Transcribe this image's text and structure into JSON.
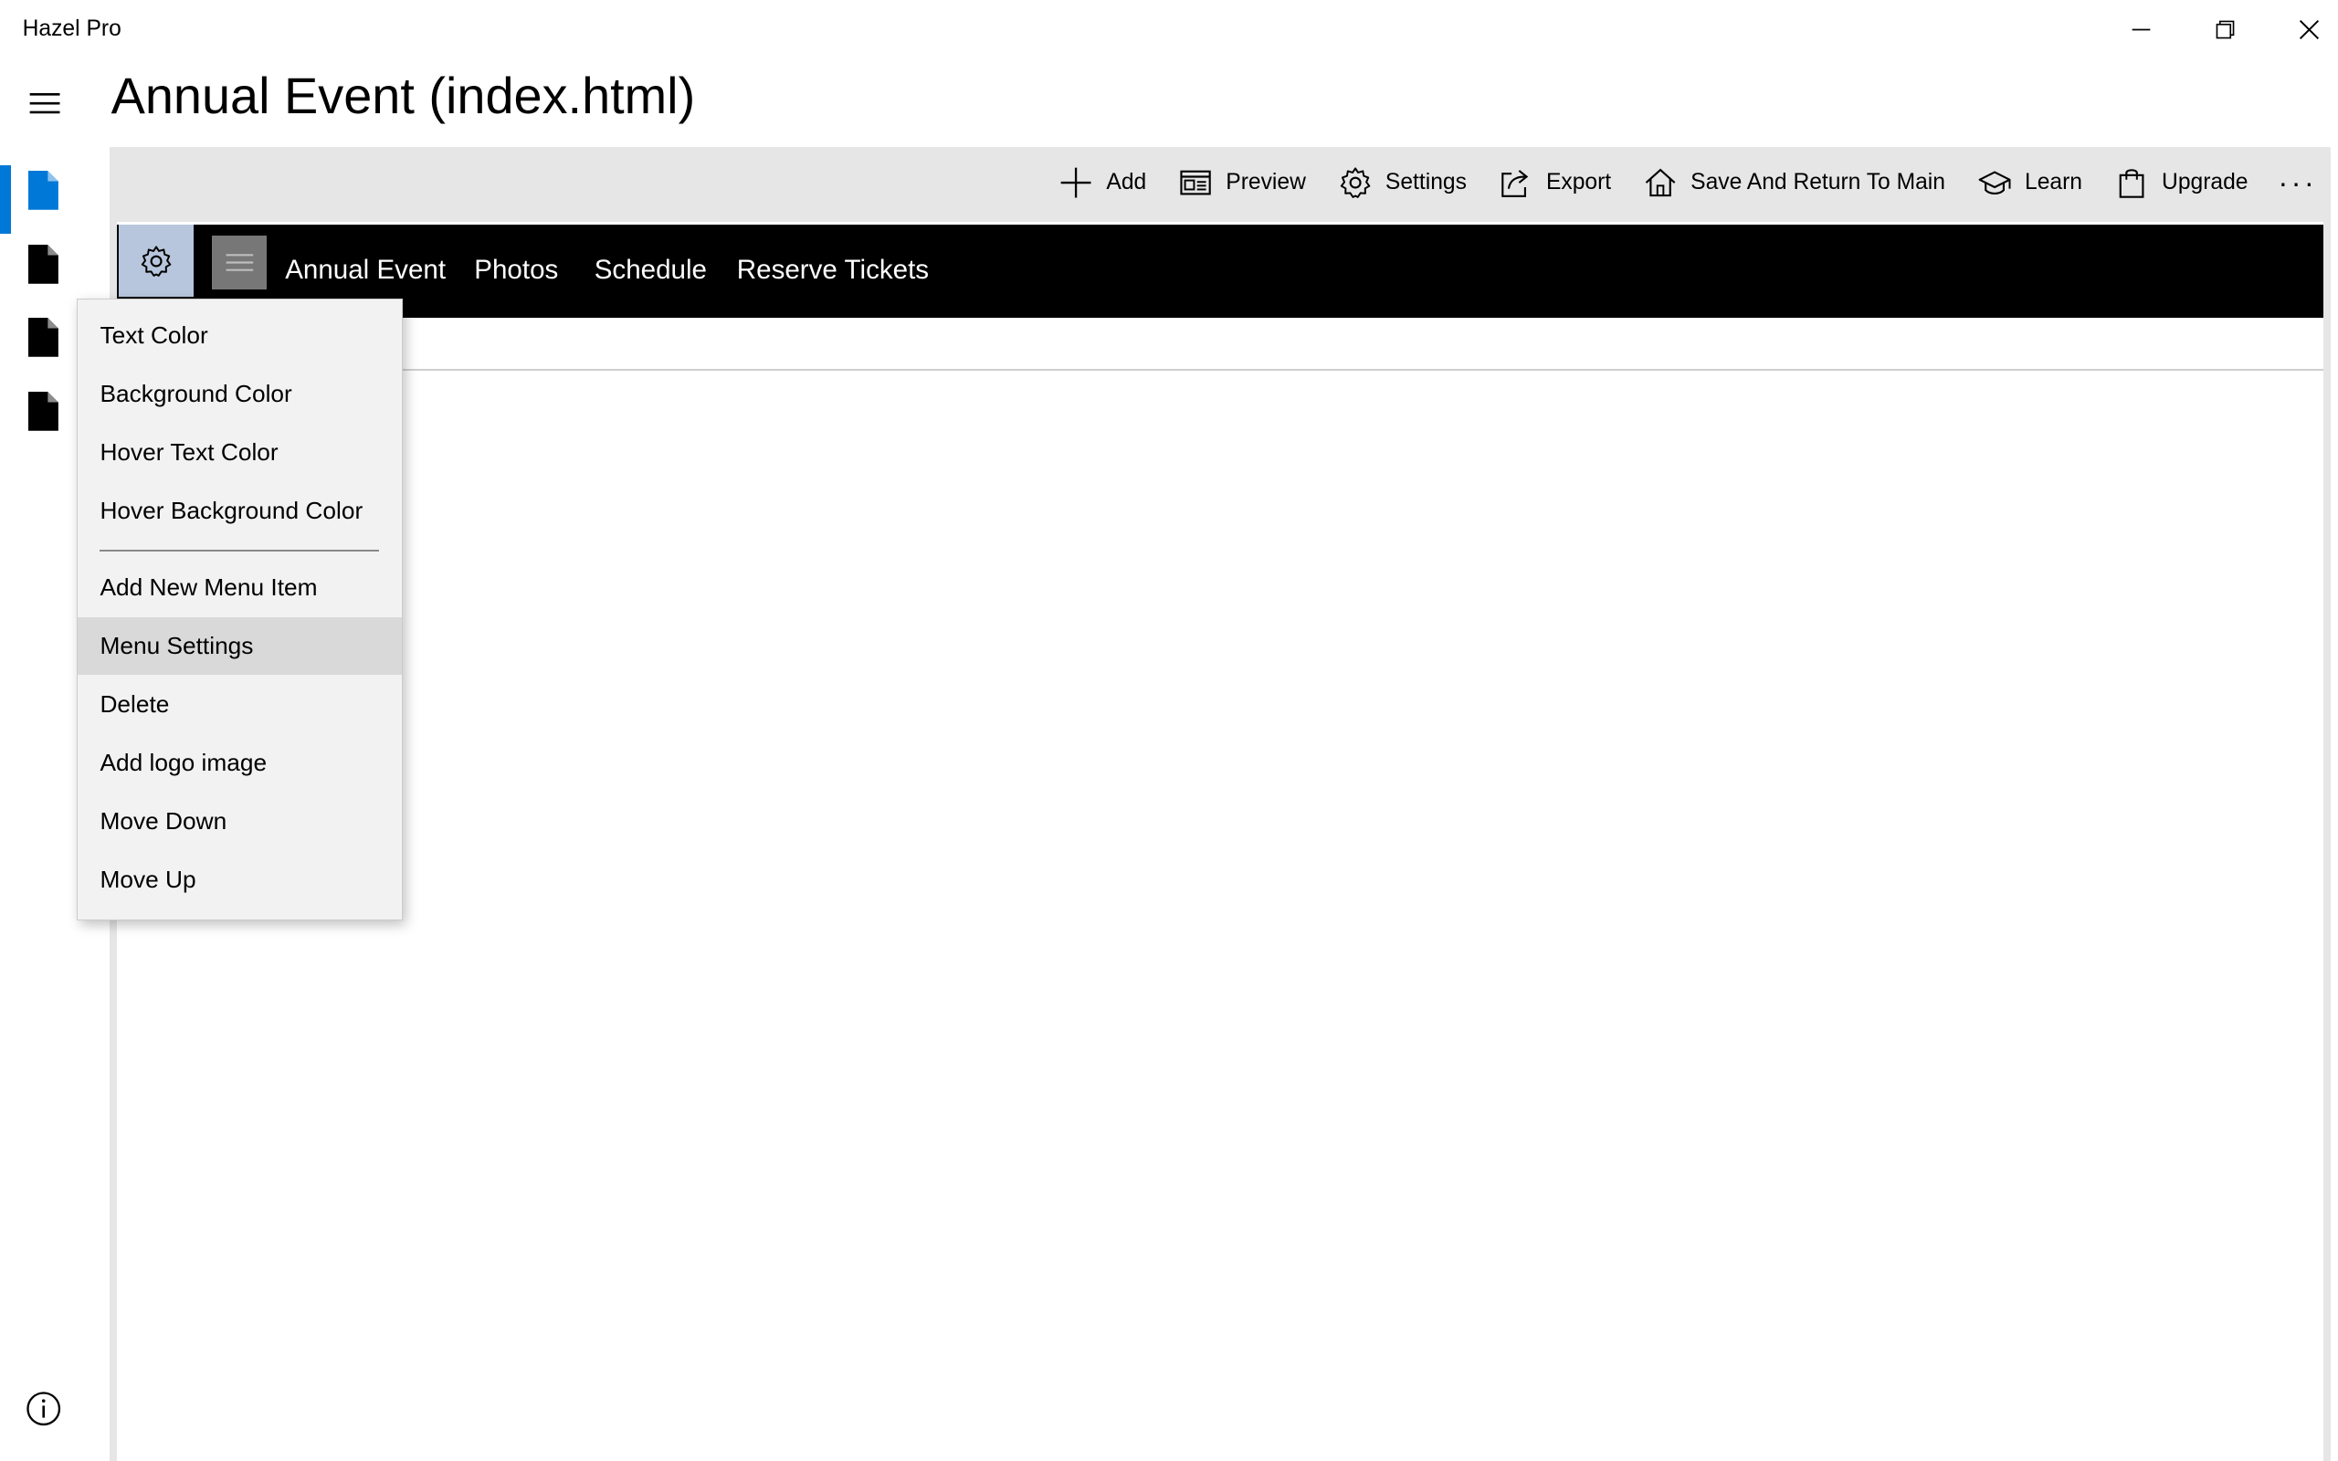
{
  "app": {
    "title": "Hazel Pro"
  },
  "window": {
    "minimize": "minimize",
    "restore": "restore",
    "close": "close"
  },
  "header": {
    "title": "Annual Event (index.html)"
  },
  "rail": {
    "pages": [
      "page-icon",
      "page-icon",
      "page-icon",
      "page-icon"
    ],
    "selected_index": 0,
    "accent": "#0078d7"
  },
  "toolbar": {
    "add": "Add",
    "preview": "Preview",
    "settings": "Settings",
    "export": "Export",
    "save_return": "Save And Return To Main",
    "learn": "Learn",
    "upgrade": "Upgrade",
    "more": "···"
  },
  "navbar": {
    "items": [
      "Annual Event",
      "Photos",
      "Schedule",
      "Reserve Tickets"
    ],
    "background": "#000000",
    "text_color": "#ffffff"
  },
  "context_menu": {
    "items": [
      "Text Color",
      "Background Color",
      "Hover Text Color",
      "Hover Background Color",
      "Add New Menu Item",
      "Menu Settings",
      "Delete",
      "Add logo image",
      "Move Down",
      "Move Up"
    ],
    "highlighted": "Menu Settings"
  }
}
